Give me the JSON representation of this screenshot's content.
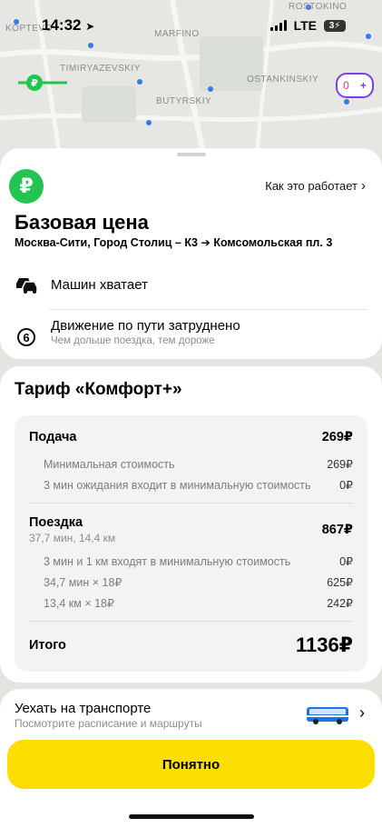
{
  "status_bar": {
    "time": "14:32",
    "network": "LTE",
    "battery": "3"
  },
  "map": {
    "labels": [
      "KOPTEVO",
      "MARFINO",
      "TIMIRYAZEVSKIY",
      "OSTANKINSKIY",
      "BUTYRSKIY",
      "ROSTOKINO"
    ],
    "chip_value": "0"
  },
  "header": {
    "badge_symbol": "₽",
    "how_it_works": "Как это работает",
    "title": "Базовая цена",
    "route": "Москва-Сити, Город Столиц – К3 ➔ Комсомольская пл. 3"
  },
  "conditions": {
    "cars": "Машин хватает",
    "traffic_title": "Движение по пути затруднено",
    "traffic_sub": "Чем дольше поездка, тем дороже",
    "traffic_level": "6"
  },
  "tariff": {
    "title": "Тариф «Комфорт+»",
    "pickup": {
      "label": "Подача",
      "amount": "269₽",
      "lines": [
        {
          "label": "Минимальная стоимость",
          "amount": "269₽"
        },
        {
          "label": "3 мин ожидания входит в минимальную стоимость",
          "amount": "0₽"
        }
      ]
    },
    "trip": {
      "label": "Поездка",
      "subtitle": "37,7 мин, 14,4 км",
      "amount": "867₽",
      "lines": [
        {
          "label": "3 мин и 1 км входят в минимальную стоимость",
          "amount": "0₽"
        },
        {
          "label": "34,7 мин × 18₽",
          "amount": "625₽"
        },
        {
          "label": "13,4 км × 18₽",
          "amount": "242₽"
        }
      ]
    },
    "total": {
      "label": "Итого",
      "amount": "1136₽"
    }
  },
  "transit": {
    "title": "Уехать на транспорте",
    "subtitle": "Посмотрите расписание и маршруты"
  },
  "confirm_button": "Понятно",
  "colors": {
    "brand_yellow": "#fcdf00",
    "ruble_green": "#23c452"
  }
}
